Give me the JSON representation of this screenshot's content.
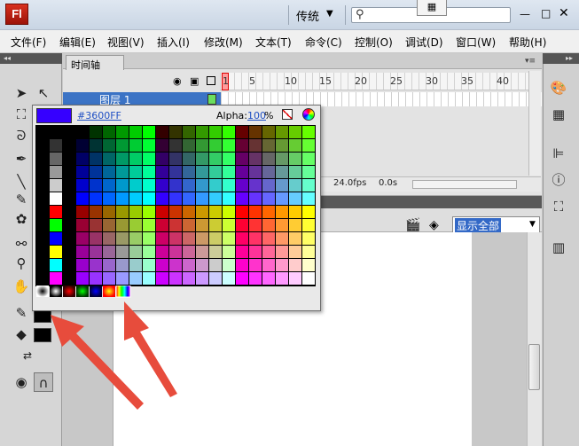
{
  "app": {
    "logo_text": "Fl",
    "workspace": "传统",
    "workspace_arrow": "▼"
  },
  "window": {
    "minimize": "—",
    "maximize": "□",
    "close": "✕",
    "search_icon": "⚲",
    "tool_tab_icon": "▦"
  },
  "menu": [
    "文件(F)",
    "编辑(E)",
    "视图(V)",
    "插入(I)",
    "修改(M)",
    "文本(T)",
    "命令(C)",
    "控制(O)",
    "调试(D)",
    "窗口(W)",
    "帮助(H)"
  ],
  "timeline": {
    "tab_label": "时间轴",
    "frame_numbers": [
      "1",
      "5",
      "10",
      "15",
      "20",
      "25",
      "30",
      "35",
      "40"
    ],
    "layer_name": "图层 1",
    "fps": "24.0fps",
    "seconds": "0.0s"
  },
  "editbar": {
    "zoom": "显示全部"
  },
  "color_picker": {
    "hex": "#3600FF",
    "preview_color": "#3600FF",
    "alpha_label": "Alpha:",
    "alpha_value": "100",
    "alpha_unit": "%"
  },
  "tools": {
    "panel_collapse": "◂◂",
    "right_panel_collapse": "▸▸",
    "stroke_color": "#000000",
    "fill_color": "#000000"
  },
  "icons": {
    "tools": [
      "selection-icon",
      "subselection-icon",
      "free-transform-icon",
      "lasso-icon",
      "pen-icon",
      "text-icon",
      "line-icon",
      "pencil-icon",
      "deco-icon",
      "bone-icon",
      "eyedropper-icon",
      "hand-icon",
      "stroke-pencil-icon",
      "paint-bucket-icon",
      "swap-colors-icon",
      "object-drawing-icon",
      "snap-icon"
    ],
    "right": [
      "color-palette-icon",
      "swatches-icon",
      "align-icon",
      "info-icon",
      "transform-icon",
      "library-icon"
    ]
  }
}
